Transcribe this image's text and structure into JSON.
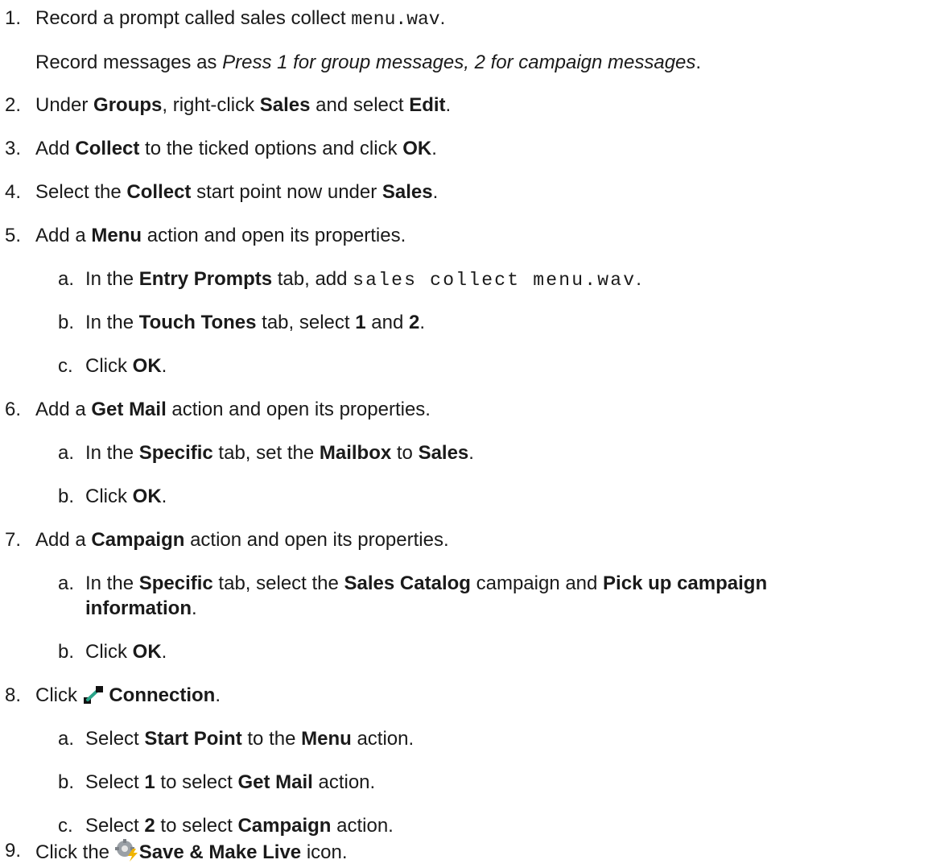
{
  "steps": [
    {
      "num": "1.",
      "parts": [
        "Record a prompt called sales collect ",
        "menu.wav",
        "."
      ],
      "detail": [
        "Record messages as ",
        "Press 1 for group messages, 2 for campaign messages",
        "."
      ]
    },
    {
      "num": "2.",
      "parts": [
        "Under ",
        "Groups",
        ", right-click ",
        "Sales",
        " and select ",
        "Edit",
        "."
      ]
    },
    {
      "num": "3.",
      "parts": [
        "Add ",
        "Collect",
        " to the ticked options and click ",
        "OK",
        "."
      ]
    },
    {
      "num": "4.",
      "parts": [
        "Select the ",
        "Collect",
        " start point now under ",
        "Sales",
        "."
      ]
    },
    {
      "num": "5.",
      "parts": [
        "Add a ",
        "Menu",
        " action and open its properties."
      ],
      "sub": [
        {
          "letter": "a.",
          "parts": [
            "In the ",
            "Entry Prompts",
            " tab, add ",
            "sales collect menu.wav",
            "."
          ]
        },
        {
          "letter": "b.",
          "parts": [
            "In the ",
            "Touch Tones",
            " tab, select ",
            "1",
            " and ",
            "2",
            "."
          ]
        },
        {
          "letter": "c.",
          "parts": [
            "Click ",
            "OK",
            "."
          ]
        }
      ]
    },
    {
      "num": "6.",
      "parts": [
        "Add a ",
        "Get Mail",
        " action and open its properties."
      ],
      "sub": [
        {
          "letter": "a.",
          "parts": [
            "In the ",
            "Specific",
            " tab, set the ",
            "Mailbox",
            " to ",
            "Sales",
            "."
          ]
        },
        {
          "letter": "b.",
          "parts": [
            "Click ",
            "OK",
            "."
          ]
        }
      ]
    },
    {
      "num": "7.",
      "parts": [
        "Add a ",
        "Campaign",
        " action and open its properties."
      ],
      "sub": [
        {
          "letter": "a.",
          "parts": [
            "In the ",
            "Specific",
            " tab, select the ",
            "Sales Catalog",
            " campaign and ",
            "Pick up campaign",
            "information",
            "."
          ]
        },
        {
          "letter": "b.",
          "parts": [
            "Click ",
            "OK",
            "."
          ]
        }
      ]
    },
    {
      "num": "8.",
      "parts": [
        "Click ",
        "Connection",
        "."
      ],
      "icon": "connection-icon",
      "sub": [
        {
          "letter": "a.",
          "parts": [
            "Select ",
            "Start Point",
            " to the ",
            "Menu",
            " action."
          ]
        },
        {
          "letter": "b.",
          "parts": [
            "Select ",
            "1",
            " to select ",
            "Get Mail",
            " action."
          ]
        },
        {
          "letter": "c.",
          "parts": [
            "Select ",
            "2",
            " to select ",
            "Campaign",
            " action."
          ]
        }
      ]
    },
    {
      "num": "9.",
      "parts": [
        "Click the ",
        "Save & Make Live",
        " icon."
      ],
      "icon": "save-and-make-live-icon"
    }
  ],
  "colors": {
    "text": "#1a1a1a",
    "connection_icon": "#2aa58a",
    "save_icon_gear": "#9aa0a6",
    "save_icon_lightning": "#f0b400"
  }
}
